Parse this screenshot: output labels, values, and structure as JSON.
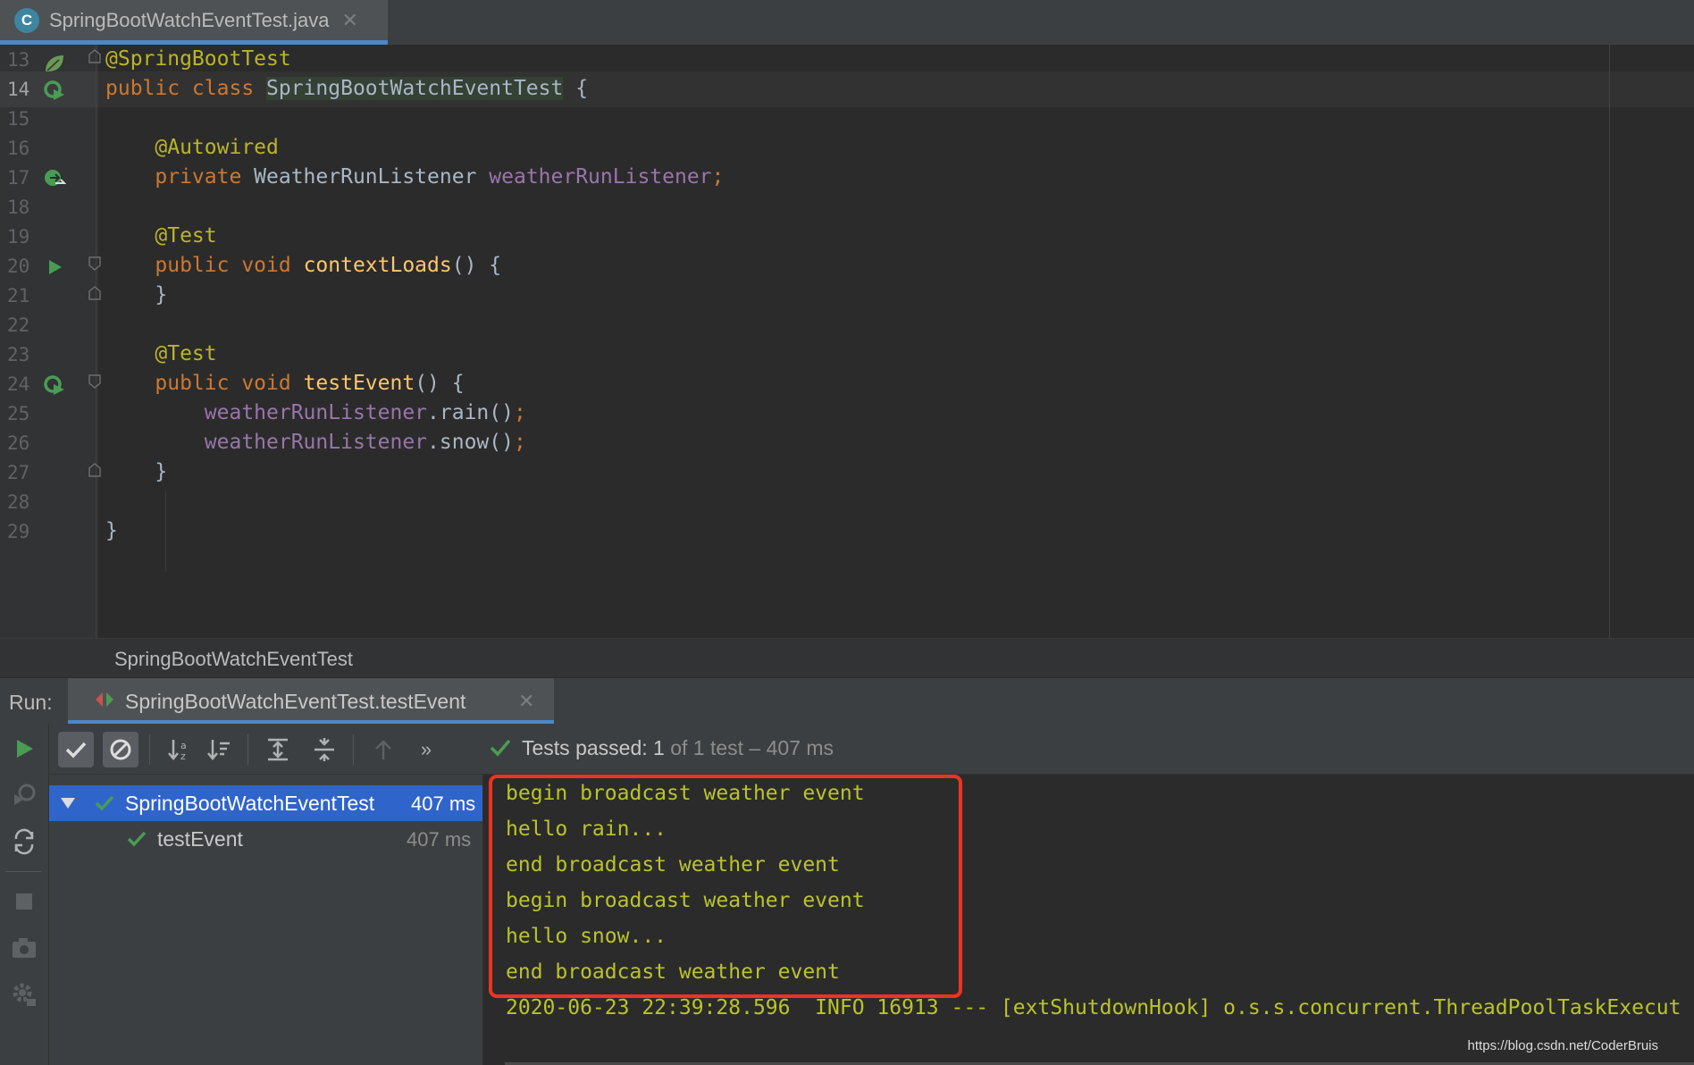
{
  "editor_tab": {
    "icon_letter": "C",
    "file_name": "SpringBootWatchEventTest.java",
    "close": "✕"
  },
  "code_lines": [
    {
      "num": "13",
      "tokens": [
        {
          "t": "@SpringBootTest",
          "c": "ann"
        }
      ]
    },
    {
      "num": "14",
      "tokens": [
        {
          "t": "public class ",
          "c": "kw"
        },
        {
          "t": "SpringBootWatchEventTest",
          "c": "pl cls-hl"
        },
        {
          "t": " {",
          "c": "pl"
        }
      ]
    },
    {
      "num": "15",
      "tokens": []
    },
    {
      "num": "16",
      "tokens": [
        {
          "t": "    @Autowired",
          "c": "ann"
        }
      ]
    },
    {
      "num": "17",
      "tokens": [
        {
          "t": "    private ",
          "c": "kw"
        },
        {
          "t": "WeatherRunListener ",
          "c": "pl"
        },
        {
          "t": "weatherRunListener",
          "c": "fld"
        },
        {
          "t": ";",
          "c": "kw"
        }
      ]
    },
    {
      "num": "18",
      "tokens": []
    },
    {
      "num": "19",
      "tokens": [
        {
          "t": "    @Test",
          "c": "ann"
        }
      ]
    },
    {
      "num": "20",
      "tokens": [
        {
          "t": "    public void ",
          "c": "kw"
        },
        {
          "t": "contextLoads",
          "c": "mth"
        },
        {
          "t": "() {",
          "c": "pl"
        }
      ]
    },
    {
      "num": "21",
      "tokens": [
        {
          "t": "    }",
          "c": "pl"
        }
      ]
    },
    {
      "num": "22",
      "tokens": []
    },
    {
      "num": "23",
      "tokens": [
        {
          "t": "    @Test",
          "c": "ann"
        }
      ]
    },
    {
      "num": "24",
      "tokens": [
        {
          "t": "    public void ",
          "c": "kw"
        },
        {
          "t": "testEvent",
          "c": "mth"
        },
        {
          "t": "() {",
          "c": "pl"
        }
      ]
    },
    {
      "num": "25",
      "tokens": [
        {
          "t": "        ",
          "c": "pl"
        },
        {
          "t": "weatherRunListener",
          "c": "fld"
        },
        {
          "t": ".rain()",
          "c": "pl"
        },
        {
          "t": ";",
          "c": "kw"
        }
      ]
    },
    {
      "num": "26",
      "tokens": [
        {
          "t": "        ",
          "c": "pl"
        },
        {
          "t": "weatherRunListener",
          "c": "fld"
        },
        {
          "t": ".snow()",
          "c": "pl"
        },
        {
          "t": ";",
          "c": "kw"
        }
      ]
    },
    {
      "num": "27",
      "tokens": [
        {
          "t": "    }",
          "c": "pl"
        }
      ]
    },
    {
      "num": "28",
      "tokens": []
    },
    {
      "num": "29",
      "tokens": [
        {
          "t": "}",
          "c": "pl"
        }
      ]
    }
  ],
  "breadcrumb": "SpringBootWatchEventTest",
  "run_panel": {
    "label": "Run:",
    "tab_title": "SpringBootWatchEventTest.testEvent",
    "tab_close": "✕",
    "more_glyph": "»",
    "status_prefix": "Tests passed: ",
    "status_count": "1",
    "status_suffix": " of 1 test – 407 ms"
  },
  "test_tree": [
    {
      "name": "SpringBootWatchEventTest",
      "time": "407 ms",
      "selected": true
    },
    {
      "name": "testEvent",
      "time": "407 ms",
      "selected": false
    }
  ],
  "console_lines": [
    "begin broadcast weather event",
    "hello rain...",
    "end broadcast weather event",
    "begin broadcast weather event",
    "hello snow...",
    "end broadcast weather event",
    "2020-06-23 22:39:28.596  INFO 16913 --- [extShutdownHook] o.s.s.concurrent.ThreadPoolTaskExecut"
  ],
  "watermark": "https://blog.csdn.net/CoderBruis",
  "colors": {
    "keyword": "#cc7832",
    "annotation": "#bbb529",
    "field": "#9876aa",
    "method": "#ffc66d",
    "console": "#b9c42a",
    "highlight_box": "#f0331f",
    "selection": "#2f65ca",
    "pass_green": "#499c54"
  }
}
